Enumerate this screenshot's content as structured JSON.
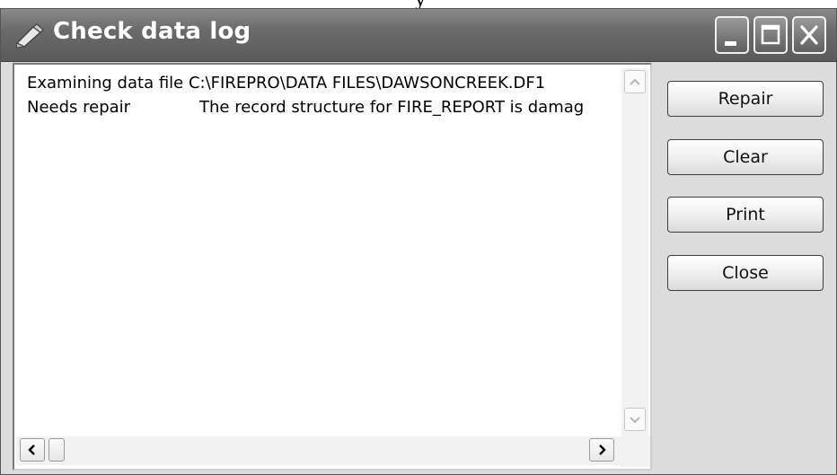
{
  "page_fragment": "y",
  "window": {
    "title": "Check data log",
    "title_icon": "pencil-icon",
    "controls": [
      "minimize-icon",
      "maximize-icon",
      "close-icon"
    ]
  },
  "log": {
    "line1": "Examining data file C:\\FIREPRO\\DATA FILES\\DAWSONCREEK.DF1",
    "line2_status": "Needs repair",
    "line2_message": "The record structure for FIRE_REPORT is damag"
  },
  "buttons": {
    "repair": "Repair",
    "clear": "Clear",
    "print": "Print",
    "close": "Close"
  },
  "colors": {
    "titlebar": "#6b6b6b",
    "title_text": "#ffffff",
    "background": "#dcdcdc"
  }
}
